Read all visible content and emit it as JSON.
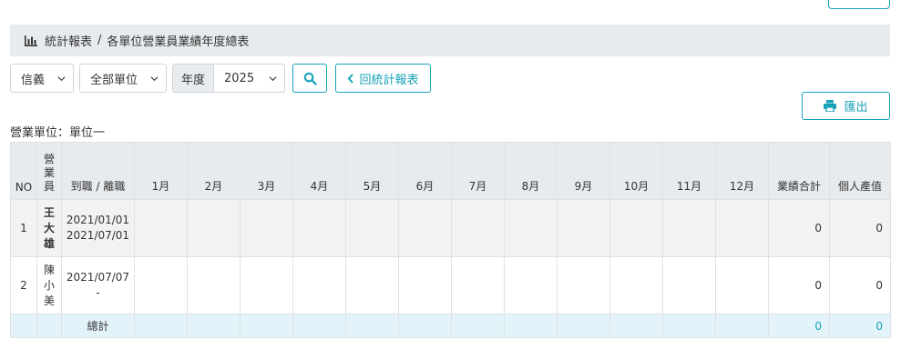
{
  "breadcrumb": {
    "section": "統計報表",
    "separator": "/",
    "page": "各單位營業員業績年度總表"
  },
  "filters": {
    "branch": "信義",
    "unit": "全部單位",
    "year_label": "年度",
    "year": "2025",
    "back_label": "回統計報表"
  },
  "export_label": "匯出",
  "unit_label": "營業單位：單位一",
  "table": {
    "headers": [
      "NO",
      "營業員",
      "到職 / 離職",
      "1月",
      "2月",
      "3月",
      "4月",
      "5月",
      "6月",
      "7月",
      "8月",
      "9月",
      "10月",
      "11月",
      "12月",
      "業績合計",
      "個人產值"
    ],
    "rows": [
      {
        "no": "1",
        "name": "王大雄",
        "join": "2021/01/01",
        "leave": "2021/07/01",
        "total": "0",
        "productivity": "0"
      },
      {
        "no": "2",
        "name": "陳小美",
        "join": "2021/07/07",
        "leave": "-",
        "total": "0",
        "productivity": "0"
      }
    ],
    "footer": {
      "label": "總計",
      "total": "0",
      "productivity": "0"
    }
  },
  "colors": {
    "accent": "#17a2b8",
    "header_bg": "#e8ebee",
    "total_bg": "#e3f3fa"
  },
  "icons": [
    "bar-chart-icon",
    "chevron-down-icon",
    "search-icon",
    "chevron-left-icon",
    "print-icon"
  ]
}
